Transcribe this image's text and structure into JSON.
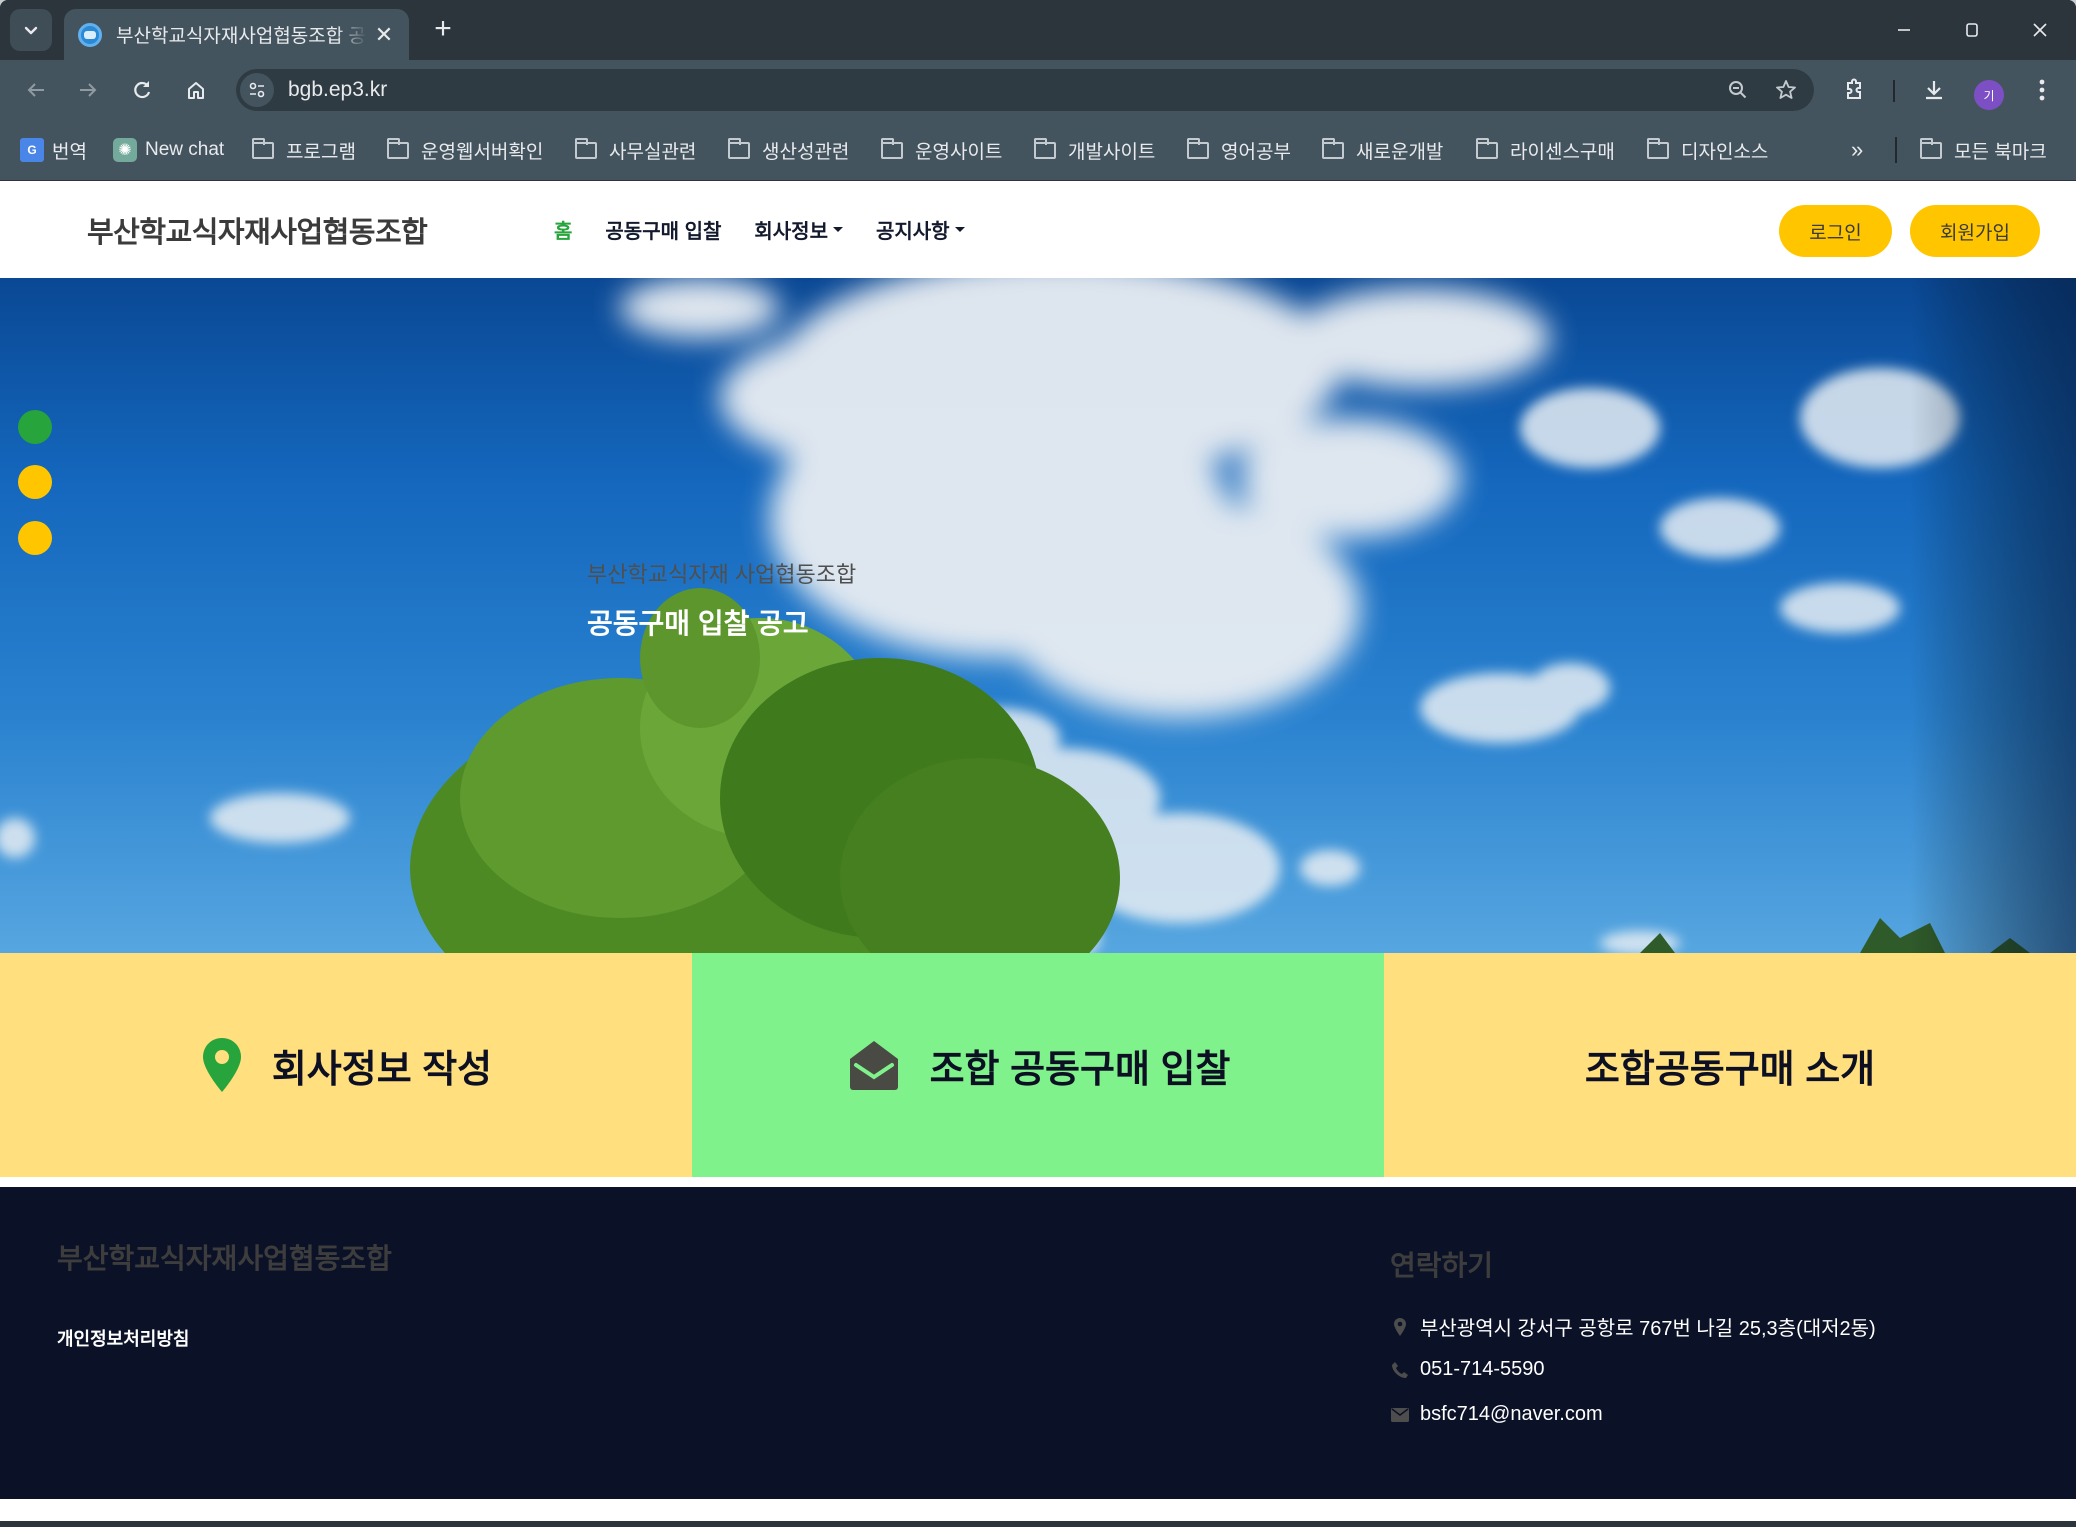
{
  "browser": {
    "tab_title": "부산학교식자재사업협동조합 공동구매 입찰 공고",
    "url": "bgb.ep3.kr",
    "profile_initial": "기",
    "bookmarks": [
      {
        "label": "번역",
        "icon": "google-translate-icon"
      },
      {
        "label": "New chat",
        "icon": "chatgpt-icon"
      },
      {
        "label": "프로그램",
        "icon": "folder-icon"
      },
      {
        "label": "운영웹서버확인",
        "icon": "folder-icon"
      },
      {
        "label": "사무실관련",
        "icon": "folder-icon"
      },
      {
        "label": "생산성관련",
        "icon": "folder-icon"
      },
      {
        "label": "운영사이트",
        "icon": "folder-icon"
      },
      {
        "label": "개발사이트",
        "icon": "folder-icon"
      },
      {
        "label": "영어공부",
        "icon": "folder-icon"
      },
      {
        "label": "새로운개발",
        "icon": "folder-icon"
      },
      {
        "label": "라이센스구매",
        "icon": "folder-icon"
      },
      {
        "label": "디자인소스",
        "icon": "folder-icon"
      }
    ],
    "bookmarks_overflow": "»",
    "all_bookmarks": "모든 북마크"
  },
  "site": {
    "logo": "부산학교식자재사업협동조합",
    "nav": [
      {
        "label": "홈",
        "active": true,
        "dropdown": false
      },
      {
        "label": "공동구매 입찰",
        "active": false,
        "dropdown": false
      },
      {
        "label": "회사정보",
        "active": false,
        "dropdown": true
      },
      {
        "label": "공지사항",
        "active": false,
        "dropdown": true
      }
    ],
    "login": "로그인",
    "signup": "회원가입",
    "accent_green": "#27a43b",
    "accent_yellow": "#ffc600"
  },
  "hero": {
    "subtitle": "부산학교식자재 사업협동조합",
    "title": "공동구매 입찰 공고",
    "slides": [
      {
        "active": true,
        "color": "#27a43b"
      },
      {
        "active": false,
        "color": "#ffc600"
      },
      {
        "active": false,
        "color": "#ffc600"
      }
    ]
  },
  "features": [
    {
      "label": "회사정보 작성",
      "icon": "map-marker-icon",
      "bg": "#ffdf7e"
    },
    {
      "label": "조합 공동구매 입찰",
      "icon": "envelope-open-icon",
      "bg": "#80f28c"
    },
    {
      "label": "조합공동구매 소개",
      "icon": "",
      "bg": "#ffdf7e"
    }
  ],
  "footer": {
    "brand": "부산학교식자재사업협동조합",
    "privacy_policy": "개인정보처리방침",
    "contact_title": "연락하기",
    "address": "부산광역시 강서구 공항로 767번 나길 25,3층(대저2동)",
    "phone": "051-714-5590",
    "email": "bsfc714@naver.com"
  }
}
